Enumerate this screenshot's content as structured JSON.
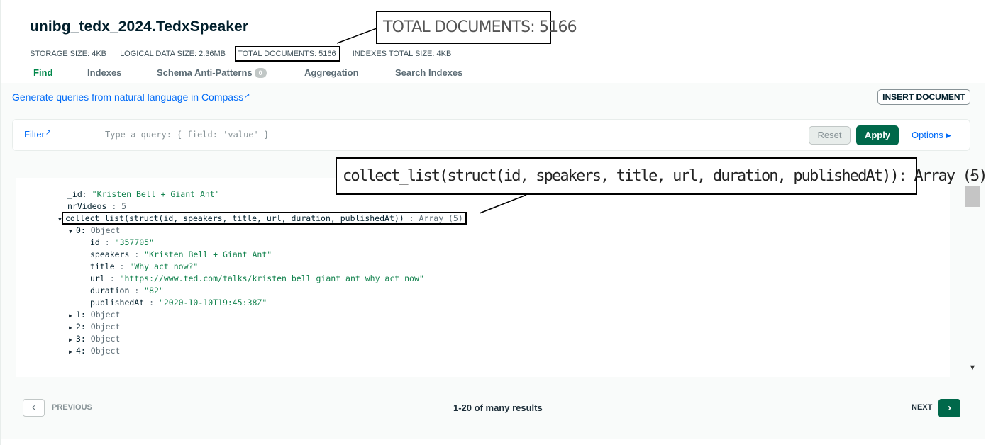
{
  "header": {
    "collection_title": "unibg_tedx_2024.TedxSpeaker",
    "stats": {
      "storage_size": "STORAGE SIZE: 4KB",
      "logical_data_size": "LOGICAL DATA SIZE: 2.36MB",
      "total_documents": "TOTAL DOCUMENTS: 5166",
      "indexes_total_size": "INDEXES TOTAL SIZE: 4KB"
    }
  },
  "callouts": {
    "total_documents": "TOTAL DOCUMENTS: 5166",
    "collect_list": "collect_list(struct(id, speakers, title, url, duration, publishedAt)): Array (5)"
  },
  "tabs": [
    {
      "label": "Find",
      "active": true
    },
    {
      "label": "Indexes"
    },
    {
      "label": "Schema Anti-Patterns",
      "badge": "0"
    },
    {
      "label": "Aggregation"
    },
    {
      "label": "Search Indexes"
    }
  ],
  "toolbar": {
    "natural_language_link": "Generate queries from natural language in Compass",
    "insert_document": "INSERT DOCUMENT"
  },
  "filter": {
    "label": "Filter",
    "placeholder": "Type a query: { field: 'value' }",
    "reset": "Reset",
    "apply": "Apply",
    "options": "Options"
  },
  "document": {
    "id_key": "_id",
    "id_value": "\"Kristen Bell + Giant Ant\"",
    "nr_videos_key": "nrVideos",
    "nr_videos_value": "5",
    "array_key": "collect_list(struct(id, speakers, title, url, duration, publishedAt))",
    "array_type": "Array (5)",
    "object_type": "Object",
    "items": [
      {
        "index": "0:",
        "expanded": true
      },
      {
        "index": "1:"
      },
      {
        "index": "2:"
      },
      {
        "index": "3:"
      },
      {
        "index": "4:"
      }
    ],
    "item0_fields": [
      {
        "key": "id",
        "value": "\"357705\""
      },
      {
        "key": "speakers",
        "value": "\"Kristen Bell + Giant Ant\""
      },
      {
        "key": "title",
        "value": "\"Why act now?\""
      },
      {
        "key": "url",
        "value": "\"https://www.ted.com/talks/kristen_bell_giant_ant_why_act_now\""
      },
      {
        "key": "duration",
        "value": "\"82\""
      },
      {
        "key": "publishedAt",
        "value": "\"2020-10-10T19:45:38Z\""
      }
    ]
  },
  "pagination": {
    "previous": "PREVIOUS",
    "results": "1-20 of many results",
    "next": "NEXT"
  },
  "colors": {
    "brand_green": "#00684a",
    "active_tab": "#00874a",
    "link_blue": "#016bf8",
    "string_green": "#12824d"
  }
}
